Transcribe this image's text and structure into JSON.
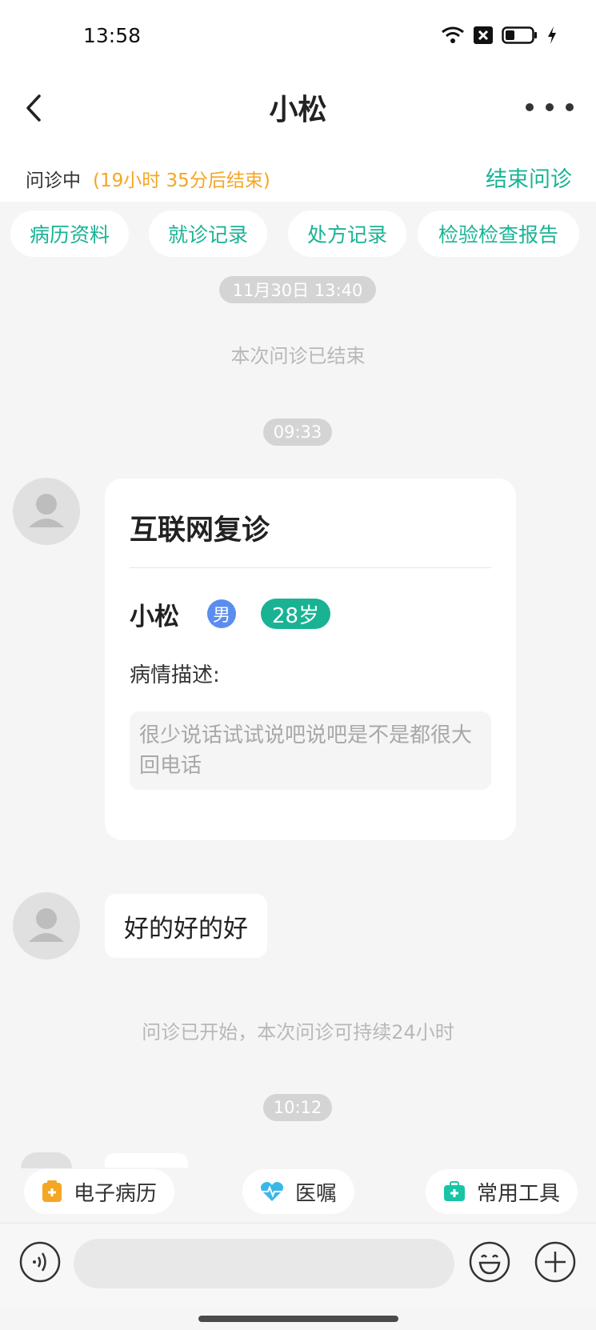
{
  "status_bar": {
    "time": "13:58"
  },
  "header": {
    "title": "小松"
  },
  "consult": {
    "status_label": "问诊中",
    "remaining": "(19小时 35分后结束)",
    "end_button": "结束问诊"
  },
  "chips": [
    "病历资料",
    "就诊记录",
    "处方记录",
    "检验检查报告"
  ],
  "chat": {
    "timestamp_1": "11月30日 13:40",
    "ended_msg": "本次问诊已结束",
    "timestamp_2": "09:33",
    "card": {
      "title": "互联网复诊",
      "patient_name": "小松",
      "gender": "男",
      "age": "28岁",
      "desc_label": "病情描述:",
      "desc_text": "很少说话试试说吧说吧是不是都很大回电话"
    },
    "bubble_text": "好的好的好",
    "started_msg": "问诊已开始，本次问诊可持续24小时",
    "timestamp_3": "10:12"
  },
  "tools": [
    "电子病历",
    "医嘱",
    "常用工具"
  ],
  "colors": {
    "accent": "#19b394",
    "warning": "#f5a623",
    "gender_badge": "#5b8def"
  }
}
